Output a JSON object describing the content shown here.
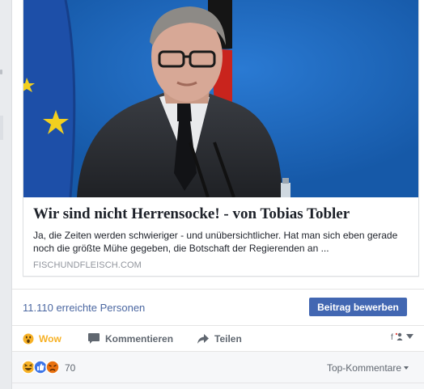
{
  "link_preview": {
    "title": "Wir sind nicht Herrensocke! - von Tobias Tobler",
    "description": "Ja, die Zeiten werden schwieriger - und unübersichtlicher. Hat man sich eben gerade noch die größte Mühe gegeben, die Botschaft der Regierenden an ...",
    "domain": "FISCHUNDFLEISCH.COM"
  },
  "insights": {
    "reach": "11.110 erreichte Personen",
    "boost_label": "Beitrag bewerben"
  },
  "actions": {
    "wow": "Wow",
    "comment": "Kommentieren",
    "share": "Teilen"
  },
  "reactions": {
    "count": "70",
    "sort_label": "Top-Kommentare"
  },
  "colors": {
    "brand_blue": "#4267b2",
    "wow_yellow": "#f7b125",
    "link_blue": "#4b67a1"
  },
  "icons": [
    "wow-icon",
    "comment-icon",
    "share-icon",
    "audience-icon",
    "like-reaction-icon",
    "haha-reaction-icon",
    "angry-reaction-icon",
    "caret-down-icon"
  ]
}
